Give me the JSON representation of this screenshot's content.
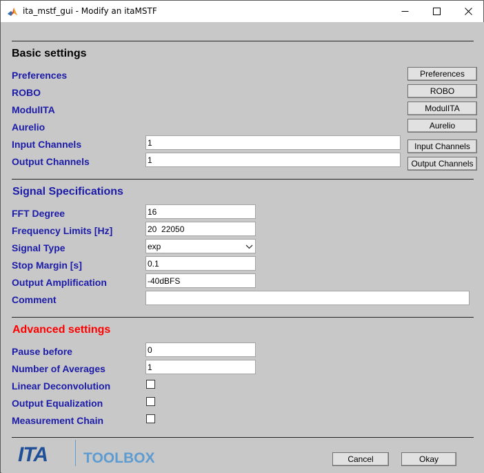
{
  "window": {
    "title": "ita_mstf_gui - Modify an itaMSTF"
  },
  "basic": {
    "heading": "Basic settings",
    "preferences_label": "Preferences",
    "robo_label": "ROBO",
    "modulita_label": "ModulITA",
    "aurelio_label": "Aurelio",
    "input_channels_label": "Input Channels",
    "output_channels_label": "Output Channels",
    "input_channels_value": "1",
    "output_channels_value": "1",
    "buttons": {
      "preferences": "Preferences",
      "robo": "ROBO",
      "modulita": "ModulITA",
      "aurelio": "Aurelio",
      "input_channels": "Input Channels",
      "output_channels": "Output Channels"
    }
  },
  "signal": {
    "heading": "Signal Specifications",
    "fft_degree_label": "FFT Degree",
    "fft_degree_value": "16",
    "frequency_limits_label": "Frequency Limits [Hz]",
    "frequency_limits_value": "20  22050",
    "signal_type_label": "Signal Type",
    "signal_type_value": "exp",
    "stop_margin_label": "Stop Margin [s]",
    "stop_margin_value": "0.1",
    "output_amplification_label": "Output Amplification",
    "output_amplification_value": "-40dBFS",
    "comment_label": "Comment",
    "comment_value": ""
  },
  "advanced": {
    "heading": "Advanced settings",
    "pause_before_label": "Pause before",
    "pause_before_value": "0",
    "number_of_averages_label": "Number of Averages",
    "number_of_averages_value": "1",
    "linear_deconvolution_label": "Linear Deconvolution",
    "linear_deconvolution_checked": false,
    "output_equalization_label": "Output Equalization",
    "output_equalization_checked": false,
    "measurement_chain_label": "Measurement Chain",
    "measurement_chain_checked": false
  },
  "footer": {
    "logo_ita": "ITA",
    "logo_toolbox": "TOOLBOX",
    "cancel": "Cancel",
    "okay": "Okay"
  },
  "colors": {
    "label_blue": "#1b1ba8",
    "advanced_red": "#ff0000",
    "logo_blue": "#1f4f97",
    "logo_light_blue": "#5e9bd0"
  },
  "icons": {
    "app": "matlab-icon",
    "minimize": "minimize-icon",
    "maximize": "maximize-icon",
    "close": "close-icon",
    "dropdown": "chevron-down-icon"
  }
}
